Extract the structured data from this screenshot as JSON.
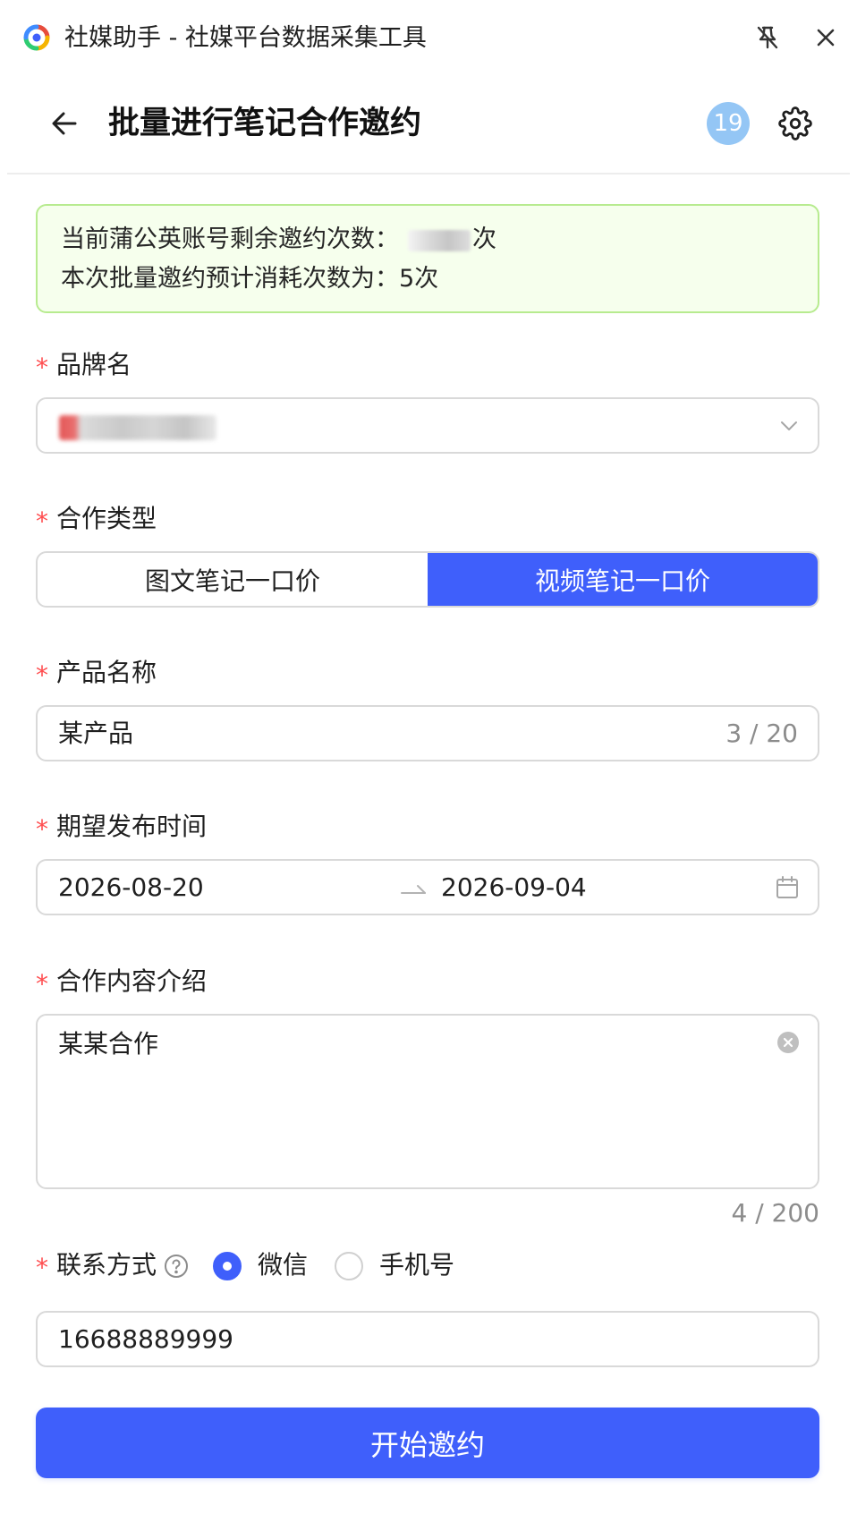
{
  "app": {
    "title": "社媒助手 - 社媒平台数据采集工具"
  },
  "header": {
    "title": "批量进行笔记合作邀约",
    "badge_count": "19"
  },
  "notice": {
    "remaining_prefix": "当前蒲公英账号剩余邀约次数：",
    "remaining_suffix": "次",
    "estimate_text": "本次批量邀约预计消耗次数为：5次"
  },
  "form": {
    "brand": {
      "label": "品牌名"
    },
    "cooperation_type": {
      "label": "合作类型",
      "options": [
        "图文笔记一口价",
        "视频笔记一口价"
      ],
      "selected": "视频笔记一口价"
    },
    "product_name": {
      "label": "产品名称",
      "value": "某产品",
      "count": "3 / 20"
    },
    "publish_time": {
      "label": "期望发布时间",
      "start": "2026-08-20",
      "end": "2026-09-04"
    },
    "content_intro": {
      "label": "合作内容介绍",
      "value": "某某合作",
      "count": "4 / 200"
    },
    "contact": {
      "label": "联系方式",
      "options": [
        "微信",
        "手机号"
      ],
      "selected": "微信",
      "value": "16688889999"
    },
    "submit_label": "开始邀约"
  },
  "colors": {
    "primary": "#3f5ffb",
    "badge": "#94c6f5",
    "notice_bg": "#f6ffed",
    "notice_border": "#b7eb8f",
    "required": "#ff4d4f"
  },
  "icons": [
    "app-logo-icon",
    "unpin-icon",
    "close-icon",
    "back-arrow-icon",
    "gear-icon",
    "chevron-down-icon",
    "arrow-right-icon",
    "calendar-icon",
    "clear-circle-icon",
    "question-circle-icon"
  ]
}
